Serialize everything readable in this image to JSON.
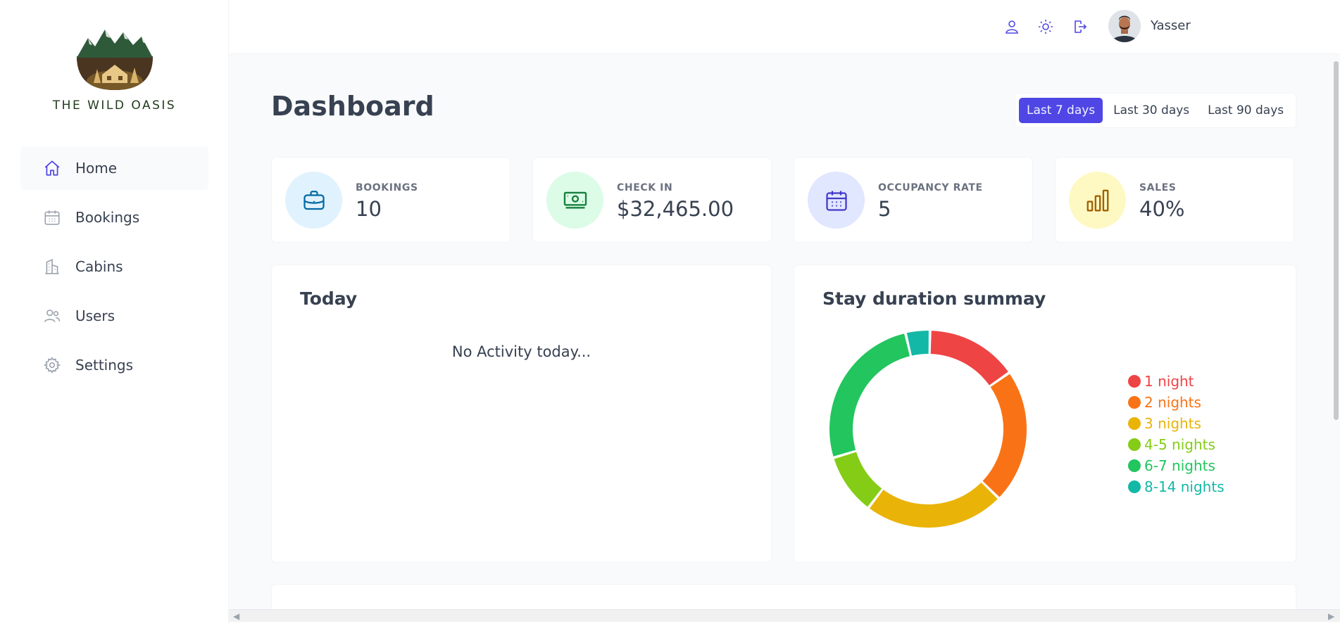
{
  "brand": {
    "name": "THE WILD OASIS"
  },
  "sidebar": {
    "items": [
      {
        "label": "Home",
        "icon": "home-icon",
        "active": true
      },
      {
        "label": "Bookings",
        "icon": "calendar-icon",
        "active": false
      },
      {
        "label": "Cabins",
        "icon": "building-icon",
        "active": false
      },
      {
        "label": "Users",
        "icon": "users-icon",
        "active": false
      },
      {
        "label": "Settings",
        "icon": "gear-icon",
        "active": false
      }
    ]
  },
  "header": {
    "user_name": "Yasser",
    "buttons": [
      "user-icon",
      "sun-icon",
      "logout-icon"
    ]
  },
  "main": {
    "title": "Dashboard",
    "filters": [
      {
        "label": "Last 7 days",
        "active": true
      },
      {
        "label": "Last 30 days",
        "active": false
      },
      {
        "label": "Last 90 days",
        "active": false
      }
    ],
    "stats": [
      {
        "label": "BOOKINGS",
        "value": "10",
        "icon": "briefcase-icon",
        "color": "#0369a1",
        "bg": "#e0f2fe"
      },
      {
        "label": "CHECK IN",
        "value": "$32,465.00",
        "icon": "banknotes-icon",
        "color": "#15803d",
        "bg": "#dcfce7"
      },
      {
        "label": "OCCUPANCY RATE",
        "value": "5",
        "icon": "calendar-days-icon",
        "color": "#4338ca",
        "bg": "#e0e7ff"
      },
      {
        "label": "SALES",
        "value": "40%",
        "icon": "chart-bar-icon",
        "color": "#a16207",
        "bg": "#fef9c3"
      }
    ],
    "today": {
      "title": "Today",
      "empty_message": "No Activity today..."
    },
    "duration": {
      "title": "Stay duration summay"
    }
  },
  "chart_data": {
    "type": "pie",
    "title": "Stay duration summay",
    "donut": true,
    "legend_position": "right",
    "series": [
      {
        "name": "1 night",
        "value": 1.5,
        "color": "#ef4444"
      },
      {
        "name": "2 nights",
        "value": 2.2,
        "color": "#f97316"
      },
      {
        "name": "3 nights",
        "value": 2.3,
        "color": "#eab308"
      },
      {
        "name": "4-5 nights",
        "value": 1.0,
        "color": "#84cc16"
      },
      {
        "name": "6-7 nights",
        "value": 2.6,
        "color": "#22c55e"
      },
      {
        "name": "8-14 nights",
        "value": 0.4,
        "color": "#14b8a6"
      }
    ]
  }
}
